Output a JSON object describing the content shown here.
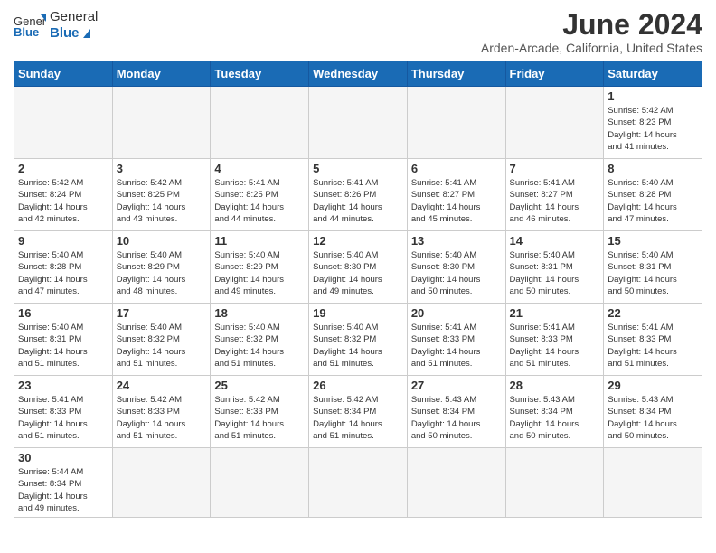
{
  "header": {
    "logo_general": "General",
    "logo_blue": "Blue",
    "month": "June 2024",
    "location": "Arden-Arcade, California, United States"
  },
  "weekdays": [
    "Sunday",
    "Monday",
    "Tuesday",
    "Wednesday",
    "Thursday",
    "Friday",
    "Saturday"
  ],
  "weeks": [
    [
      {
        "day": "",
        "info": ""
      },
      {
        "day": "",
        "info": ""
      },
      {
        "day": "",
        "info": ""
      },
      {
        "day": "",
        "info": ""
      },
      {
        "day": "",
        "info": ""
      },
      {
        "day": "",
        "info": ""
      },
      {
        "day": "1",
        "info": "Sunrise: 5:42 AM\nSunset: 8:23 PM\nDaylight: 14 hours\nand 41 minutes."
      }
    ],
    [
      {
        "day": "2",
        "info": "Sunrise: 5:42 AM\nSunset: 8:24 PM\nDaylight: 14 hours\nand 42 minutes."
      },
      {
        "day": "3",
        "info": "Sunrise: 5:42 AM\nSunset: 8:25 PM\nDaylight: 14 hours\nand 43 minutes."
      },
      {
        "day": "4",
        "info": "Sunrise: 5:41 AM\nSunset: 8:25 PM\nDaylight: 14 hours\nand 44 minutes."
      },
      {
        "day": "5",
        "info": "Sunrise: 5:41 AM\nSunset: 8:26 PM\nDaylight: 14 hours\nand 44 minutes."
      },
      {
        "day": "6",
        "info": "Sunrise: 5:41 AM\nSunset: 8:27 PM\nDaylight: 14 hours\nand 45 minutes."
      },
      {
        "day": "7",
        "info": "Sunrise: 5:41 AM\nSunset: 8:27 PM\nDaylight: 14 hours\nand 46 minutes."
      },
      {
        "day": "8",
        "info": "Sunrise: 5:40 AM\nSunset: 8:28 PM\nDaylight: 14 hours\nand 47 minutes."
      }
    ],
    [
      {
        "day": "9",
        "info": "Sunrise: 5:40 AM\nSunset: 8:28 PM\nDaylight: 14 hours\nand 47 minutes."
      },
      {
        "day": "10",
        "info": "Sunrise: 5:40 AM\nSunset: 8:29 PM\nDaylight: 14 hours\nand 48 minutes."
      },
      {
        "day": "11",
        "info": "Sunrise: 5:40 AM\nSunset: 8:29 PM\nDaylight: 14 hours\nand 49 minutes."
      },
      {
        "day": "12",
        "info": "Sunrise: 5:40 AM\nSunset: 8:30 PM\nDaylight: 14 hours\nand 49 minutes."
      },
      {
        "day": "13",
        "info": "Sunrise: 5:40 AM\nSunset: 8:30 PM\nDaylight: 14 hours\nand 50 minutes."
      },
      {
        "day": "14",
        "info": "Sunrise: 5:40 AM\nSunset: 8:31 PM\nDaylight: 14 hours\nand 50 minutes."
      },
      {
        "day": "15",
        "info": "Sunrise: 5:40 AM\nSunset: 8:31 PM\nDaylight: 14 hours\nand 50 minutes."
      }
    ],
    [
      {
        "day": "16",
        "info": "Sunrise: 5:40 AM\nSunset: 8:31 PM\nDaylight: 14 hours\nand 51 minutes."
      },
      {
        "day": "17",
        "info": "Sunrise: 5:40 AM\nSunset: 8:32 PM\nDaylight: 14 hours\nand 51 minutes."
      },
      {
        "day": "18",
        "info": "Sunrise: 5:40 AM\nSunset: 8:32 PM\nDaylight: 14 hours\nand 51 minutes."
      },
      {
        "day": "19",
        "info": "Sunrise: 5:40 AM\nSunset: 8:32 PM\nDaylight: 14 hours\nand 51 minutes."
      },
      {
        "day": "20",
        "info": "Sunrise: 5:41 AM\nSunset: 8:33 PM\nDaylight: 14 hours\nand 51 minutes."
      },
      {
        "day": "21",
        "info": "Sunrise: 5:41 AM\nSunset: 8:33 PM\nDaylight: 14 hours\nand 51 minutes."
      },
      {
        "day": "22",
        "info": "Sunrise: 5:41 AM\nSunset: 8:33 PM\nDaylight: 14 hours\nand 51 minutes."
      }
    ],
    [
      {
        "day": "23",
        "info": "Sunrise: 5:41 AM\nSunset: 8:33 PM\nDaylight: 14 hours\nand 51 minutes."
      },
      {
        "day": "24",
        "info": "Sunrise: 5:42 AM\nSunset: 8:33 PM\nDaylight: 14 hours\nand 51 minutes."
      },
      {
        "day": "25",
        "info": "Sunrise: 5:42 AM\nSunset: 8:33 PM\nDaylight: 14 hours\nand 51 minutes."
      },
      {
        "day": "26",
        "info": "Sunrise: 5:42 AM\nSunset: 8:34 PM\nDaylight: 14 hours\nand 51 minutes."
      },
      {
        "day": "27",
        "info": "Sunrise: 5:43 AM\nSunset: 8:34 PM\nDaylight: 14 hours\nand 50 minutes."
      },
      {
        "day": "28",
        "info": "Sunrise: 5:43 AM\nSunset: 8:34 PM\nDaylight: 14 hours\nand 50 minutes."
      },
      {
        "day": "29",
        "info": "Sunrise: 5:43 AM\nSunset: 8:34 PM\nDaylight: 14 hours\nand 50 minutes."
      }
    ],
    [
      {
        "day": "30",
        "info": "Sunrise: 5:44 AM\nSunset: 8:34 PM\nDaylight: 14 hours\nand 49 minutes."
      },
      {
        "day": "",
        "info": ""
      },
      {
        "day": "",
        "info": ""
      },
      {
        "day": "",
        "info": ""
      },
      {
        "day": "",
        "info": ""
      },
      {
        "day": "",
        "info": ""
      },
      {
        "day": "",
        "info": ""
      }
    ]
  ]
}
